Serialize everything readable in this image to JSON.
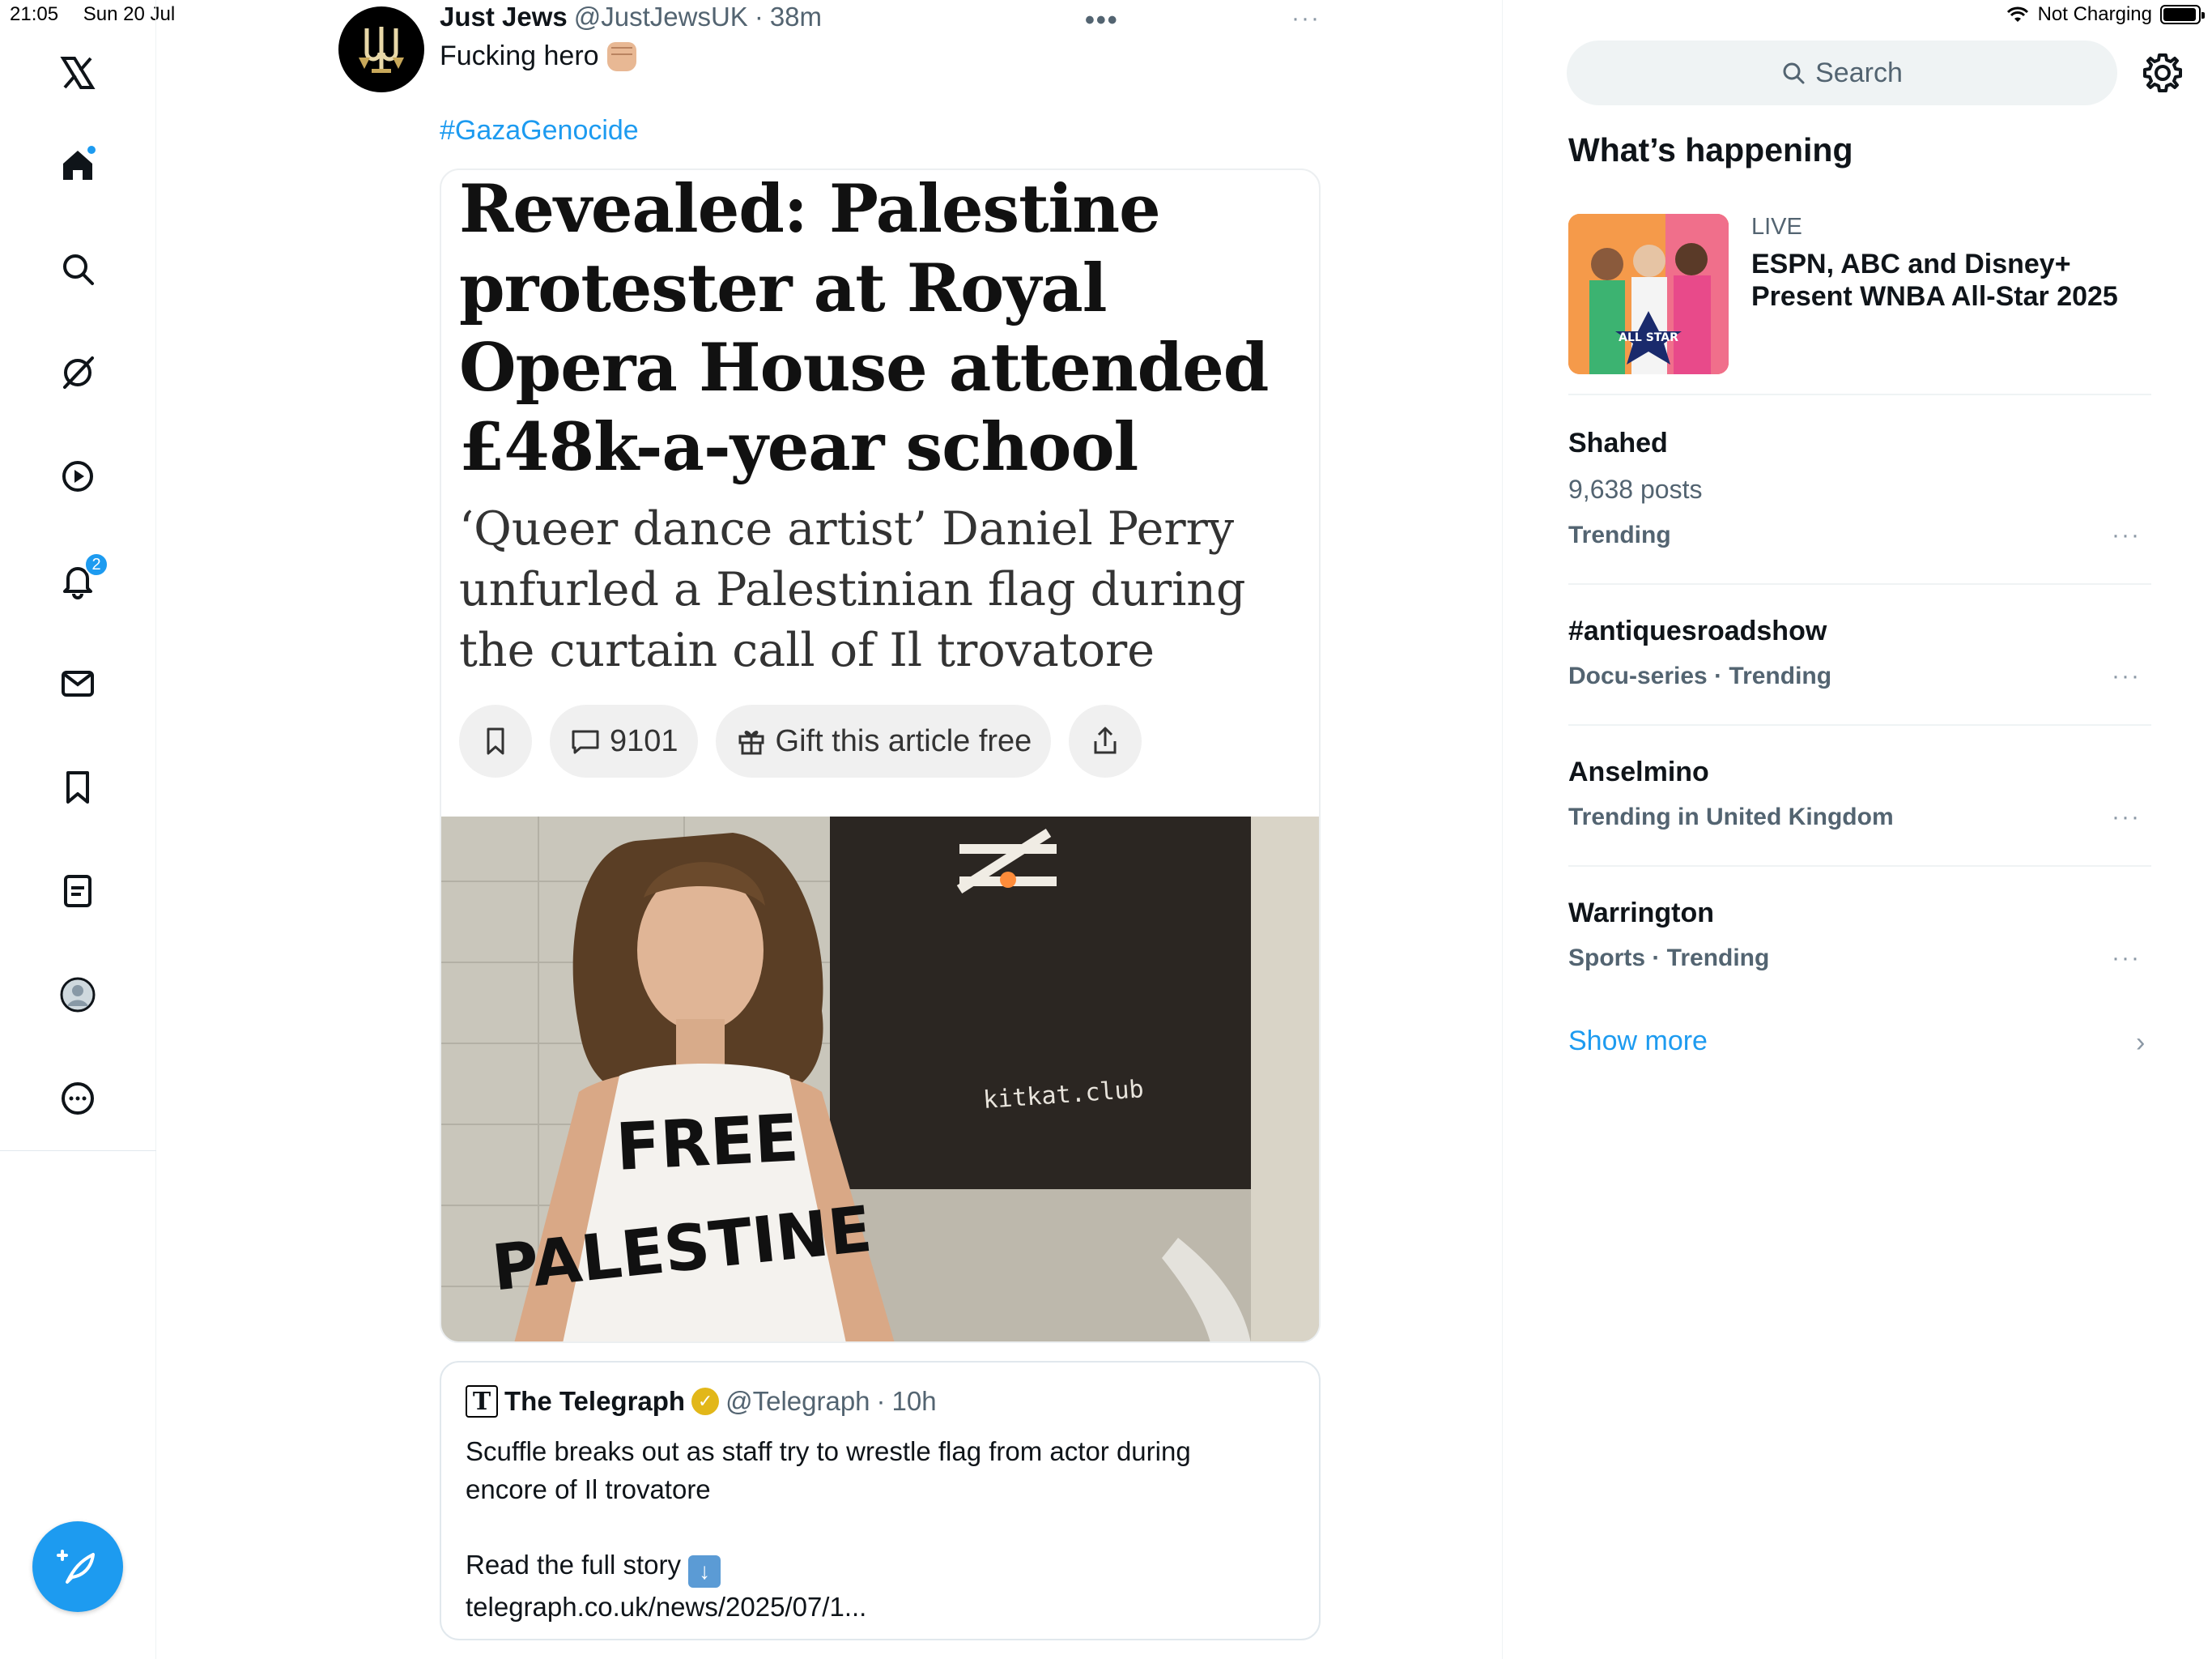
{
  "status_bar": {
    "time": "21:05",
    "date": "Sun 20 Jul",
    "charging": "Not Charging",
    "battery_level": 0.95
  },
  "nav": {
    "notifications_badge": "2"
  },
  "tweet": {
    "author_name": "Just Jews",
    "handle": "@JustJewsUK",
    "separator": "·",
    "time": "38m",
    "text": "Fucking hero",
    "hashtag": "#GazaGenocide",
    "more_label": "•••",
    "more2_label": "···"
  },
  "article": {
    "headline": "Revealed: Palestine protester at Royal Opera House attended £48k-a-year school",
    "standfirst": "‘Queer dance artist’ Daniel Perry unfurled a Palestinian flag during the curtain call of Il trovatore",
    "comment_count": "9101",
    "gift_label": "Gift this article free",
    "photo": {
      "shirt_line1": "FREE",
      "shirt_line2": "PALESTINE",
      "sign_text": "kitkat.club"
    }
  },
  "quote": {
    "logo_letter": "T",
    "author_name": "The Telegraph",
    "handle": "@Telegraph",
    "separator": "·",
    "time": "10h",
    "text": "Scuffle breaks out as staff try to wrestle flag from actor during encore of Il trovatore",
    "read_more": "Read the full story",
    "link": "telegraph.co.uk/news/2025/07/1..."
  },
  "sidebar": {
    "search_placeholder": "Search",
    "section_title": "What’s happening",
    "live": {
      "label": "LIVE",
      "title": "ESPN, ABC and Disney+ Present WNBA All-Star 2025",
      "thumb_text": "ALL STAR"
    },
    "trends": [
      {
        "name": "Shahed",
        "posts": "9,638 posts",
        "meta": "Trending"
      },
      {
        "name": "#antiquesroadshow",
        "meta": "Docu-series · Trending"
      },
      {
        "name": "Anselmino",
        "meta": "Trending in United Kingdom"
      },
      {
        "name": "Warrington",
        "meta": "Sports · Trending"
      }
    ],
    "trend_more_label": "···",
    "show_more": "Show more",
    "chevron": "›"
  },
  "colors": {
    "accent": "#1d9bf0",
    "text": "#0f1419",
    "muted": "#536471"
  }
}
